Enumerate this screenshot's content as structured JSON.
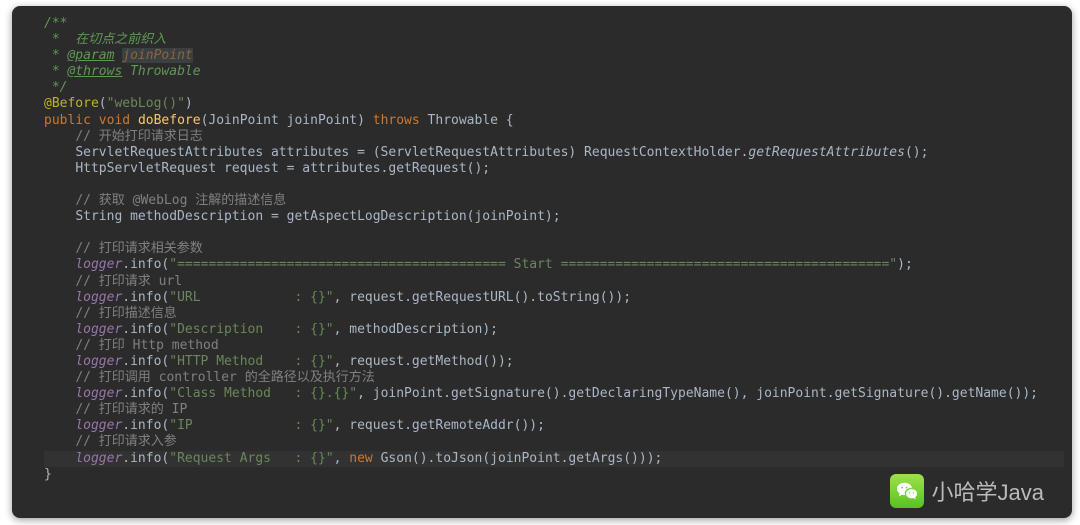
{
  "doc": {
    "l1": "/**",
    "l2": " *  在切点之前织入",
    "l3_pre": " * ",
    "l3_tag": "@param",
    "l3_name": "joinPoint",
    "l4_pre": " * ",
    "l4_tag": "@throws",
    "l4_rest": " Throwable",
    "l5": " */"
  },
  "ann": {
    "before": "@Before",
    "before_arg": "\"webLog()\""
  },
  "sig": {
    "public": "public",
    "void": "void",
    "name": "doBefore",
    "params": "(JoinPoint joinPoint) ",
    "throws": "throws",
    "throwable": " Throwable {"
  },
  "cm": {
    "startLog": "// 开始打印请求日志",
    "getDesc": "// 获取 @WebLog 注解的描述信息",
    "printParams": "// 打印请求相关参数",
    "printUrl": "// 打印请求 url",
    "printDesc": "// 打印描述信息",
    "printHttp": "// 打印 Http method",
    "printClass": "// 打印调用 controller 的全路径以及执行方法",
    "printIp": "// 打印请求的 IP",
    "printArgs": "// 打印请求入参"
  },
  "code": {
    "attrLine_a": "ServletRequestAttributes attributes = (ServletRequestAttributes) RequestContextHolder.",
    "attrLine_b": "getRequestAttributes",
    "attrLine_c": "();",
    "reqLine": "HttpServletRequest request = attributes.getRequest();",
    "descLine": "String methodDescription = getAspectLogDescription(joinPoint);",
    "closeBrace": "}"
  },
  "log": {
    "logger": "logger",
    "info": ".info(",
    "startStr": "\"========================================== Start ==========================================\"",
    "urlStr": "\"URL            : {}\"",
    "urlRest": ", request.getRequestURL().toString());",
    "descStr": "\"Description    : {}\"",
    "descRest": ", methodDescription);",
    "httpStr": "\"HTTP Method    : {}\"",
    "httpRest": ", request.getMethod());",
    "classStr": "\"Class Method   : {}.{}\"",
    "classRest": ", joinPoint.getSignature().getDeclaringTypeName(), joinPoint.getSignature().getName());",
    "ipStr": "\"IP             : {}\"",
    "ipRest": ", request.getRemoteAddr());",
    "argsStr": "\"Request Args   : {}\"",
    "argsRest_a": ", ",
    "argsRest_new": "new",
    "argsRest_b": " Gson().toJson(joinPoint.getArgs()));",
    "close": ");"
  },
  "watermark": {
    "text": "小哈学Java"
  }
}
